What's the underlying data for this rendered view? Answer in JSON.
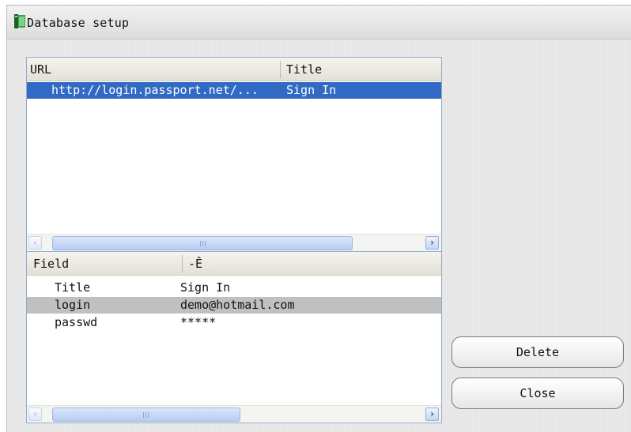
{
  "window": {
    "title": "Database setup",
    "icon": "app-book-icon"
  },
  "url_list": {
    "columns": [
      "URL",
      "Title"
    ],
    "rows": [
      {
        "url": "http://login.passport.net/...",
        "title": "Sign In",
        "selected": true
      }
    ],
    "scroll_left_icon": "‹",
    "scroll_right_icon": "›"
  },
  "field_list": {
    "columns": [
      "Field",
      "-Ê"
    ],
    "rows": [
      {
        "field": "Title",
        "value": "Sign In"
      },
      {
        "field": "login",
        "value": "demo@hotmail.com",
        "selected": true
      },
      {
        "field": "passwd",
        "value": "*****"
      }
    ],
    "scroll_left_icon": "‹",
    "scroll_right_icon": "›"
  },
  "buttons": {
    "delete": "Delete",
    "close": "Close"
  },
  "colors": {
    "selection_blue": "#316ac5",
    "selection_gray": "#c0c0c0",
    "pane_border": "#8faecb"
  }
}
